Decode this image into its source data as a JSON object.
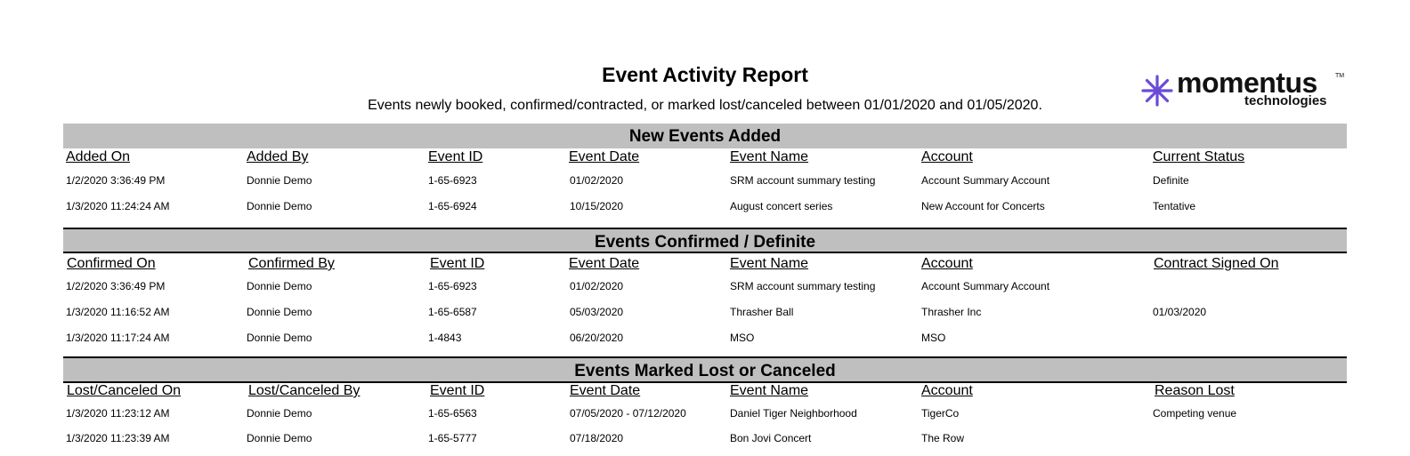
{
  "report": {
    "title": "Event Activity Report",
    "subtitle": "Events newly booked, confirmed/contracted, or marked lost/canceled between 01/01/2020 and 01/05/2020."
  },
  "logo": {
    "word": "momentus",
    "tm": "TM",
    "sub": "technologies",
    "accent": "#6a4bd8"
  },
  "sections": {
    "new": {
      "title": "New Events Added",
      "headers": [
        "Added On",
        "Added By",
        "Event ID",
        "Event Date",
        "Event Name",
        "Account",
        "Current Status"
      ],
      "rows": [
        [
          "1/2/2020 3:36:49 PM",
          "Donnie Demo",
          "1-65-6923",
          "01/02/2020",
          "SRM account summary testing",
          "Account Summary Account",
          "Definite"
        ],
        [
          "1/3/2020 11:24:24 AM",
          "Donnie Demo",
          "1-65-6924",
          "10/15/2020",
          "August concert series",
          "New Account for Concerts",
          "Tentative"
        ]
      ]
    },
    "confirmed": {
      "title": "Events Confirmed / Definite",
      "headers": [
        "Confirmed On",
        "Confirmed By",
        "Event ID",
        "Event Date",
        "Event Name",
        "Account",
        "Contract Signed On"
      ],
      "rows": [
        [
          "1/2/2020 3:36:49 PM",
          "Donnie Demo",
          "1-65-6923",
          "01/02/2020",
          "SRM account summary testing",
          "Account Summary Account",
          ""
        ],
        [
          "1/3/2020 11:16:52 AM",
          "Donnie Demo",
          "1-65-6587",
          "05/03/2020",
          "Thrasher Ball",
          "Thrasher Inc",
          "01/03/2020"
        ],
        [
          "1/3/2020 11:17:24 AM",
          "Donnie Demo",
          "1-4843",
          "06/20/2020",
          "MSO",
          "MSO",
          ""
        ]
      ]
    },
    "lost": {
      "title": "Events Marked Lost or Canceled",
      "headers": [
        "Lost/Canceled On",
        "Lost/Canceled By",
        "Event ID",
        "Event Date",
        "Event Name",
        "Account",
        "Reason Lost"
      ],
      "rows": [
        [
          "1/3/2020 11:23:12 AM",
          "Donnie Demo",
          "1-65-6563",
          "07/05/2020 - 07/12/2020",
          "Daniel Tiger Neighborhood",
          "TigerCo",
          "Competing venue"
        ],
        [
          "1/3/2020 11:23:39 AM",
          "Donnie Demo",
          "1-65-5777",
          "07/18/2020",
          "Bon Jovi Concert",
          "The Row",
          ""
        ]
      ]
    }
  }
}
